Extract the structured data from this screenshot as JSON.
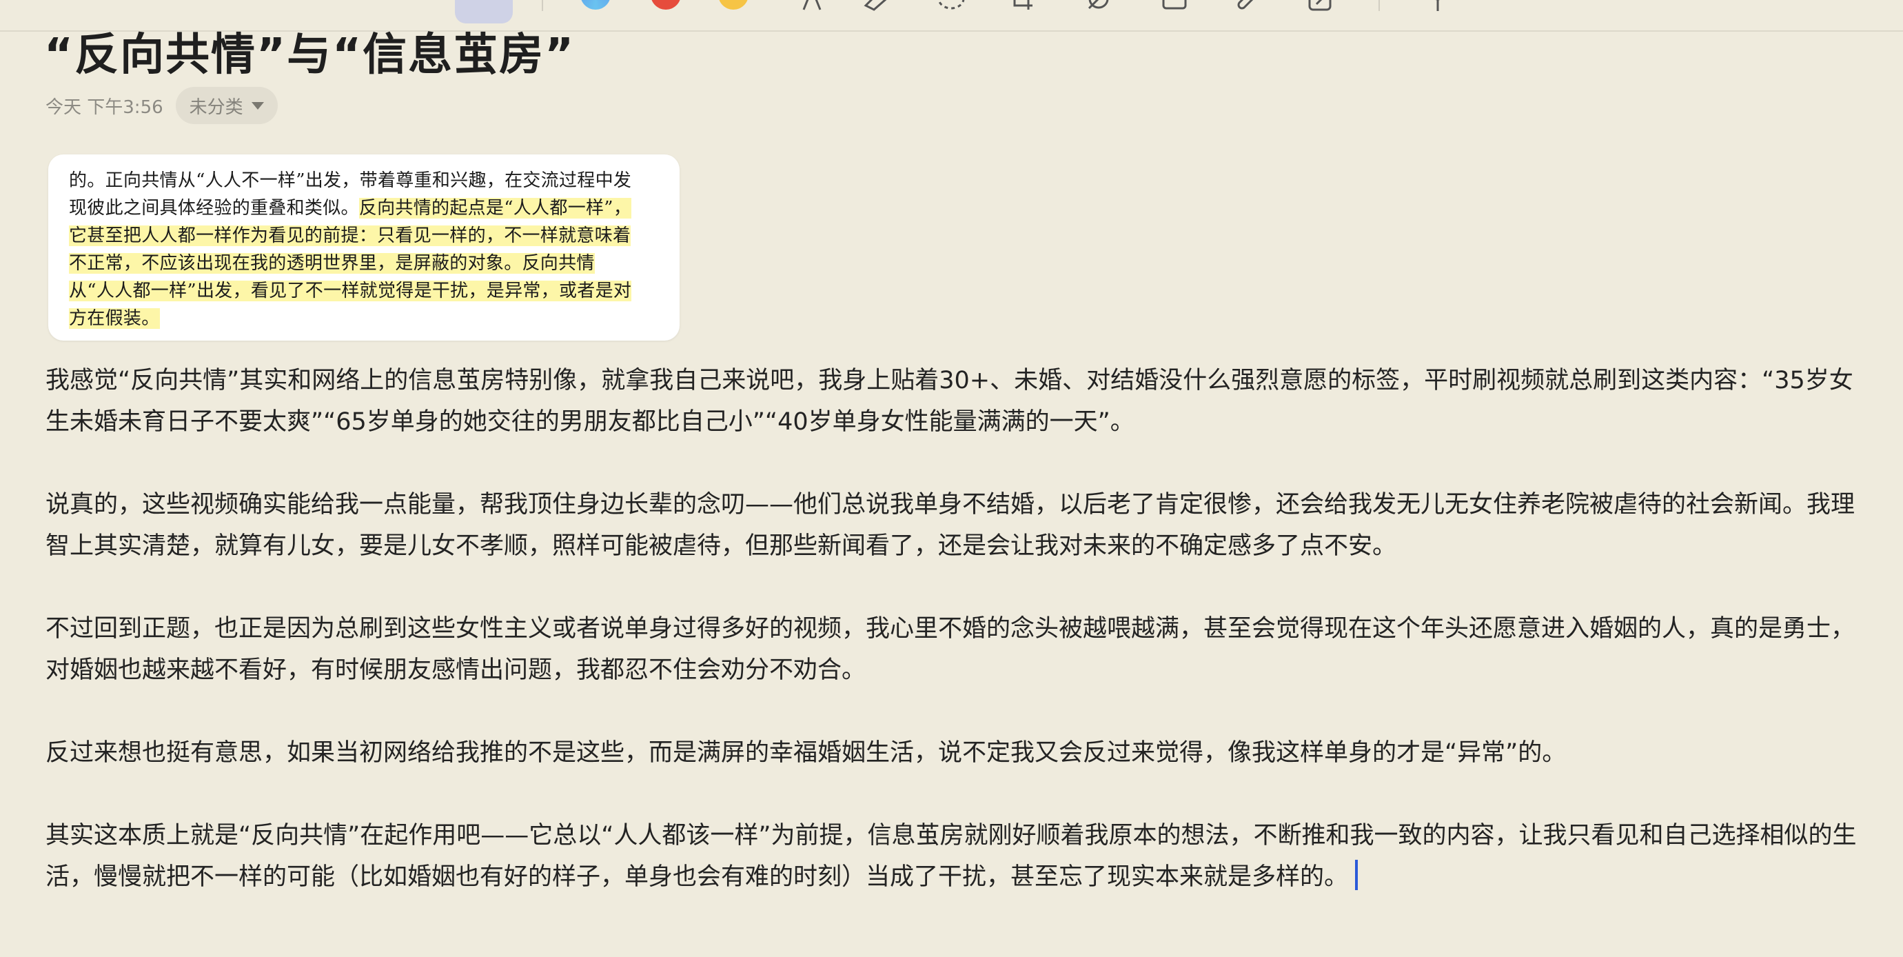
{
  "note": {
    "title": "“反向共情”与“信息茧房”",
    "timestamp": "今天 下午3:56",
    "category": "未分类",
    "quote": {
      "line1": "的。正向共情从“人人不一样”出发，带着尊重和兴趣，在交流过程中发",
      "line2a": "现彼此之间具体经验的重叠和类似。",
      "line2b": "反向共情的起点是“人人都一样”，",
      "line3": "它甚至把人人都一样作为看见的前提：只看见一样的，不一样就意味着",
      "line4": "不正常，不应该出现在我的透明世界里，是屏蔽的对象。反向共情",
      "line5": "从“人人都一样”出发，看见了不一样就觉得是干扰，是异常，或者是对",
      "line6": "方在假装。"
    },
    "paragraphs": [
      "我感觉“反向共情”其实和网络上的信息茧房特别像，就拿我自己来说吧，我身上贴着30+、未婚、对结婚没什么强烈意愿的标签，平时刷视频就总刷到这类内容：“35岁女生未婚未育日子不要太爽”“65岁单身的她交往的男朋友都比自己小”“40岁单身女性能量满满的一天”。",
      "说真的，这些视频确实能给我一点能量，帮我顶住身边长辈的念叨——他们总说我单身不结婚，以后老了肯定很惨，还会给我发无儿无女住养老院被虐待的社会新闻。我理智上其实清楚，就算有儿女，要是儿女不孝顺，照样可能被虐待，但那些新闻看了，还是会让我对未来的不确定感多了点不安。",
      "不过回到正题，也正是因为总刷到这些女性主义或者说单身过得多好的视频，我心里不婚的念头被越喂越满，甚至会觉得现在这个年头还愿意进入婚姻的人，真的是勇士，对婚姻也越来越不看好，有时候朋友感情出问题，我都忍不住会劝分不劝合。",
      "反过来想也挺有意思，如果当初网络给我推的不是这些，而是满屏的幸福婚姻生活，说不定我又会反过来觉得，像我这样单身的才是“异常”的。",
      "其实这本质上就是“反向共情”在起作用吧——它总以“人人都该一样”为前提，信息茧房就刚好顺着我原本的想法，不断推和我一致的内容，让我只看见和自己选择相似的生活，慢慢就把不一样的可能（比如婚姻也有好的样子，单身也会有难的时刻）当成了干扰，甚至忘了现实本来就是多样的。"
    ]
  },
  "toolbar": {
    "tools": [
      "text-format-icon",
      "color-blue-icon",
      "color-red-icon",
      "color-yellow-icon",
      "pen-icon",
      "eraser-icon",
      "lasso-icon",
      "crop-icon",
      "shape-icon",
      "image-icon",
      "attach-icon",
      "edit-icon",
      "pin-icon"
    ],
    "colors": {
      "blue": "#5b8fe8",
      "red": "#e64c3c",
      "yellow": "#f6c445"
    }
  },
  "colors": {
    "background": "#efebdd",
    "highlight": "#fdf6a8",
    "cursor": "#2b5ad8"
  }
}
